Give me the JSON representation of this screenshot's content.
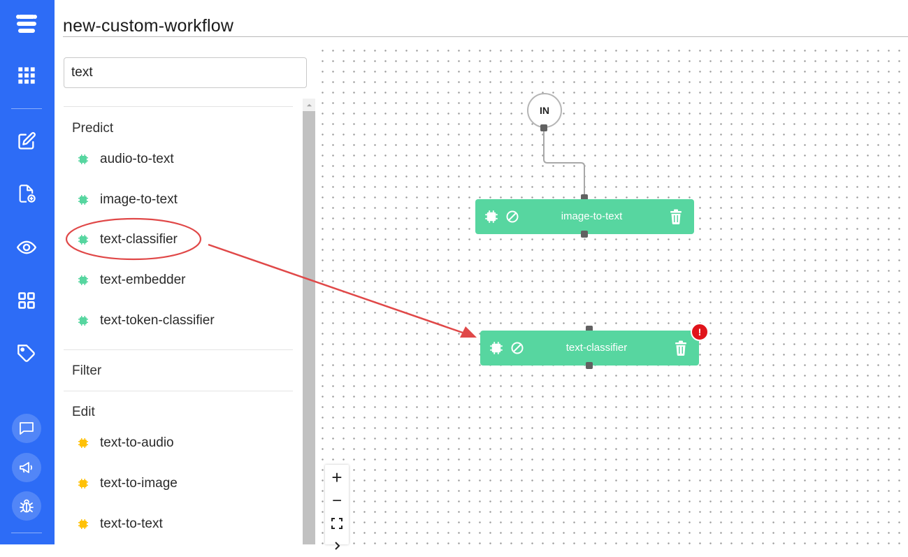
{
  "app": {
    "rail_items": [
      "logo-icon",
      "grid-apps-icon",
      "edit-icon",
      "new-file-icon",
      "eye-icon",
      "workflows-icon",
      "tag-icon",
      "chat-icon",
      "megaphone-icon",
      "bug-icon"
    ],
    "accent": "#2d6cf6"
  },
  "workflow": {
    "title": "new-custom-workflow"
  },
  "search": {
    "value": "text"
  },
  "sections": {
    "predict": {
      "title": "Predict",
      "items": [
        "audio-to-text",
        "image-to-text",
        "text-classifier",
        "text-embedder",
        "text-token-classifier"
      ],
      "chip_color": "#57d6a0"
    },
    "filter": {
      "title": "Filter"
    },
    "edit": {
      "title": "Edit",
      "items": [
        "text-to-audio",
        "text-to-image",
        "text-to-text"
      ],
      "chip_color": "#ffc107"
    }
  },
  "canvas": {
    "input_node": "IN",
    "nodes": [
      {
        "label": "image-to-text"
      },
      {
        "label": "text-classifier",
        "error": "!"
      }
    ],
    "zoom": {
      "in": "+",
      "out": "−"
    },
    "node_color": "#57d6a0",
    "annotation_color": "#e04848"
  }
}
